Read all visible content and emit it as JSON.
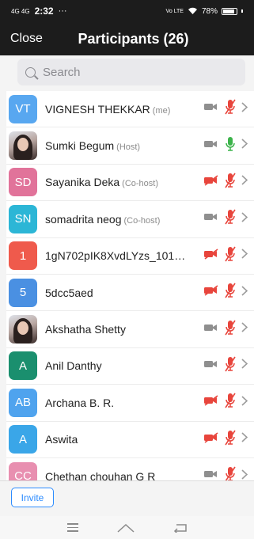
{
  "status": {
    "network": "4G 4G",
    "time": "2:32",
    "dots": "···",
    "volte": "Vo LTE",
    "battery": "78%"
  },
  "header": {
    "close_label": "Close",
    "title": "Participants (26)"
  },
  "search": {
    "placeholder": "Search"
  },
  "participants": [
    {
      "initials": "VT",
      "avatar_color": "#58a7f0",
      "name": "VIGNESH THEKKAR",
      "role": "(me)",
      "video_muted": false,
      "mic_state": "muted"
    },
    {
      "initials": "",
      "avatar_color": "photo",
      "name": "Sumki Begum",
      "role": "(Host)",
      "video_muted": false,
      "mic_state": "active"
    },
    {
      "initials": "SD",
      "avatar_color": "#e1739a",
      "name": "Sayanika Deka",
      "role": "(Co-host)",
      "video_muted": true,
      "mic_state": "muted"
    },
    {
      "initials": "SN",
      "avatar_color": "#2cb6d6",
      "name": "somadrita neog",
      "role": "(Co-host)",
      "video_muted": false,
      "mic_state": "muted"
    },
    {
      "initials": "1",
      "avatar_color": "#ef5a4c",
      "name": "1gN702pIK8XvdLYzs_101S...",
      "role": "",
      "video_muted": true,
      "mic_state": "muted"
    },
    {
      "initials": "5",
      "avatar_color": "#4a90e2",
      "name": "5dcc5aed",
      "role": "",
      "video_muted": true,
      "mic_state": "muted"
    },
    {
      "initials": "",
      "avatar_color": "photo",
      "name": "Akshatha Shetty",
      "role": "",
      "video_muted": false,
      "mic_state": "muted"
    },
    {
      "initials": "A",
      "avatar_color": "#1a8f6e",
      "name": "Anil Danthy",
      "role": "",
      "video_muted": false,
      "mic_state": "muted"
    },
    {
      "initials": "AB",
      "avatar_color": "#4fa3ee",
      "name": "Archana B. R.",
      "role": "",
      "video_muted": true,
      "mic_state": "muted"
    },
    {
      "initials": "A",
      "avatar_color": "#3aa6e8",
      "name": "Aswita",
      "role": "",
      "video_muted": true,
      "mic_state": "muted"
    },
    {
      "initials": "CC",
      "avatar_color": "#e88fb0",
      "name": "Chethan chouhan G R",
      "role": "",
      "video_muted": false,
      "mic_state": "muted"
    }
  ],
  "footer": {
    "invite_label": "Invite"
  },
  "colors": {
    "muted_red": "#e8453c",
    "active_green": "#3bb34a",
    "video_gray": "#8f8f8f",
    "accent_blue": "#2d8cff"
  }
}
